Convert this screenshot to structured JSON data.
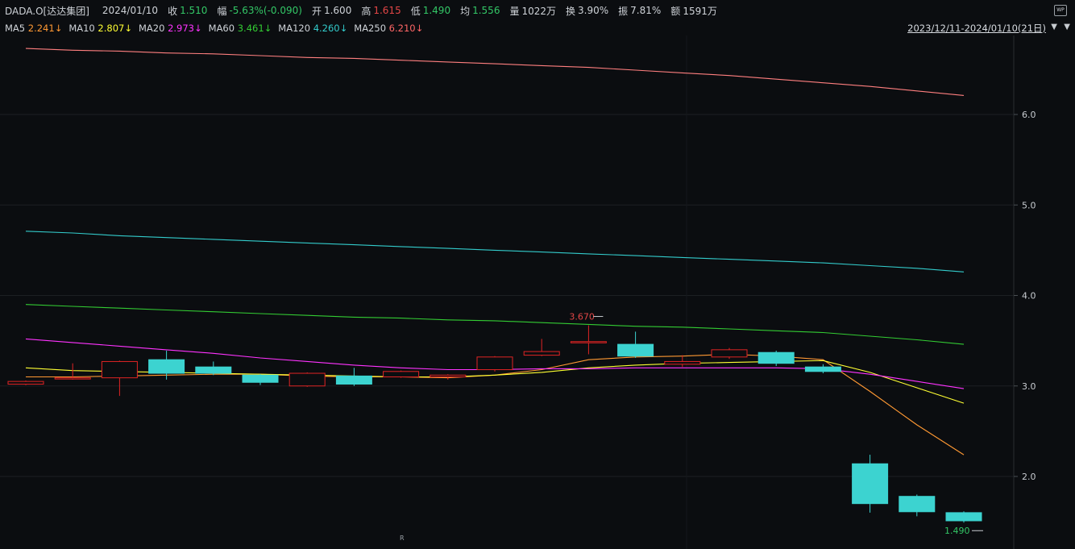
{
  "header": {
    "symbol": "DADA.O[达达集团]",
    "date": "2024/01/10",
    "close_label": "收",
    "close": "1.510",
    "change_label": "幅",
    "change": "-5.63%(-0.090)",
    "open_label": "开",
    "open": "1.600",
    "high_label": "高",
    "high": "1.615",
    "low_label": "低",
    "low": "1.490",
    "avg_label": "均",
    "avg": "1.556",
    "vol_label": "量",
    "vol": "1022万",
    "turnover_label": "换",
    "turnover": "3.90%",
    "amp_label": "振",
    "amp": "7.81%",
    "amount_label": "额",
    "amount": "1591万",
    "wp_icon": "WP"
  },
  "ma_bar": {
    "items": [
      {
        "label": "MA5",
        "value": "2.241↓",
        "color": "#ff9933"
      },
      {
        "label": "MA10",
        "value": "2.807↓",
        "color": "#ffff33"
      },
      {
        "label": "MA20",
        "value": "2.973↓",
        "color": "#ff33ff"
      },
      {
        "label": "MA60",
        "value": "3.461↓",
        "color": "#33cc33"
      },
      {
        "label": "MA120",
        "value": "4.260↓",
        "color": "#33cccc"
      },
      {
        "label": "MA250",
        "value": "6.210↓",
        "color": "#ff6666"
      }
    ],
    "range": "2023/12/11-2024/01/10(21日)"
  },
  "chart_data": {
    "type": "candlestick",
    "ylim": [
      1.4,
      6.8
    ],
    "y_ticks": [
      "2.0",
      "3.0",
      "4.0",
      "5.0",
      "6.0"
    ],
    "candles": [
      {
        "open": 3.02,
        "close": 3.05,
        "high": 3.06,
        "low": 3.01
      },
      {
        "open": 3.08,
        "close": 3.09,
        "high": 3.25,
        "low": 3.07
      },
      {
        "open": 3.09,
        "close": 3.27,
        "high": 3.28,
        "low": 2.89
      },
      {
        "open": 3.29,
        "close": 3.14,
        "high": 3.39,
        "low": 3.07
      },
      {
        "open": 3.21,
        "close": 3.14,
        "high": 3.27,
        "low": 3.12
      },
      {
        "open": 3.12,
        "close": 3.04,
        "high": 3.13,
        "low": 3.01
      },
      {
        "open": 3.0,
        "close": 3.14,
        "high": 3.15,
        "low": 2.99
      },
      {
        "open": 3.11,
        "close": 3.02,
        "high": 3.2,
        "low": 3.0
      },
      {
        "open": 3.1,
        "close": 3.16,
        "high": 3.17,
        "low": 3.09
      },
      {
        "open": 3.1,
        "close": 3.12,
        "high": 3.13,
        "low": 3.07
      },
      {
        "open": 3.18,
        "close": 3.32,
        "high": 3.33,
        "low": 3.16
      },
      {
        "open": 3.34,
        "close": 3.38,
        "high": 3.52,
        "low": 3.33
      },
      {
        "open": 3.49,
        "close": 3.49,
        "high": 3.67,
        "low": 3.35
      },
      {
        "open": 3.46,
        "close": 3.33,
        "high": 3.6,
        "low": 3.31
      },
      {
        "open": 3.24,
        "close": 3.27,
        "high": 3.34,
        "low": 3.21
      },
      {
        "open": 3.32,
        "close": 3.4,
        "high": 3.42,
        "low": 3.3
      },
      {
        "open": 3.37,
        "close": 3.25,
        "high": 3.39,
        "low": 3.22
      },
      {
        "open": 3.21,
        "close": 3.16,
        "high": 3.24,
        "low": 3.14
      },
      {
        "open": 2.14,
        "close": 1.7,
        "high": 2.24,
        "low": 1.6
      },
      {
        "open": 1.78,
        "close": 1.61,
        "high": 1.8,
        "low": 1.56
      },
      {
        "open": 1.6,
        "close": 1.51,
        "high": 1.615,
        "low": 1.49
      }
    ],
    "ma_lines": [
      {
        "name": "MA5",
        "color": "#ff9933",
        "values": [
          3.1,
          3.1,
          3.11,
          3.12,
          3.13,
          3.13,
          3.11,
          3.1,
          3.1,
          3.09,
          3.12,
          3.18,
          3.29,
          3.32,
          3.33,
          3.35,
          3.33,
          3.29,
          2.94,
          2.57,
          2.24
        ]
      },
      {
        "name": "MA10",
        "color": "#ffff33",
        "values": [
          3.2,
          3.17,
          3.16,
          3.15,
          3.14,
          3.13,
          3.12,
          3.11,
          3.1,
          3.1,
          3.12,
          3.15,
          3.2,
          3.23,
          3.25,
          3.26,
          3.27,
          3.28,
          3.15,
          2.98,
          2.81
        ]
      },
      {
        "name": "MA20",
        "color": "#ff33ff",
        "values": [
          3.52,
          3.48,
          3.44,
          3.4,
          3.36,
          3.31,
          3.27,
          3.23,
          3.2,
          3.18,
          3.18,
          3.19,
          3.19,
          3.2,
          3.2,
          3.2,
          3.2,
          3.19,
          3.13,
          3.05,
          2.97
        ]
      },
      {
        "name": "MA60",
        "color": "#33cc33",
        "values": [
          3.9,
          3.88,
          3.86,
          3.84,
          3.82,
          3.8,
          3.78,
          3.76,
          3.75,
          3.73,
          3.72,
          3.7,
          3.68,
          3.66,
          3.65,
          3.63,
          3.61,
          3.59,
          3.55,
          3.51,
          3.46
        ]
      },
      {
        "name": "MA120",
        "color": "#33cccc",
        "values": [
          4.71,
          4.69,
          4.66,
          4.64,
          4.62,
          4.6,
          4.58,
          4.56,
          4.54,
          4.52,
          4.5,
          4.48,
          4.46,
          4.44,
          4.42,
          4.4,
          4.38,
          4.36,
          4.33,
          4.3,
          4.26
        ]
      },
      {
        "name": "MA250",
        "color": "#ff7f7f",
        "values": [
          6.73,
          6.71,
          6.7,
          6.68,
          6.67,
          6.65,
          6.63,
          6.62,
          6.6,
          6.58,
          6.56,
          6.54,
          6.52,
          6.49,
          6.46,
          6.43,
          6.39,
          6.35,
          6.31,
          6.26,
          6.21
        ]
      }
    ],
    "annotations": [
      {
        "text": "3.670",
        "value": 3.67,
        "index": 12
      },
      {
        "text": "1.490",
        "value": 1.49,
        "index": 20
      }
    ],
    "up_color": "#e02424",
    "down_color": "#3cd3d0"
  }
}
